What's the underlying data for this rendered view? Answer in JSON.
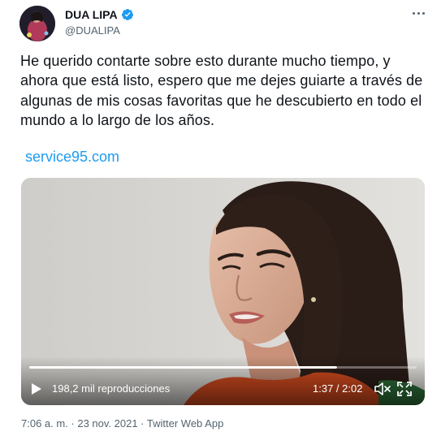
{
  "author": {
    "display_name": "DUA LIPA",
    "handle": "@DUALIPA",
    "verified_icon": "verified-badge-icon",
    "verified_color": "#1d9bf0"
  },
  "tweet": {
    "text": "He querido contarte sobre esto durante mucho tiempo, y ahora que está listo, espero que me dejes guiarte a través de algunas de mis cosas favoritas que he descubierto en todo el mundo a lo largo de los años.",
    "link": "service95.com",
    "link_color": "#1d9bf0"
  },
  "video": {
    "views": "198,2 mil reproducciones",
    "time": "1:37 / 2:02",
    "progress": 0.795
  },
  "meta": {
    "timestamp": "7:06 a. m. · 23 nov. 2021 · Twitter Web App"
  },
  "colors": {
    "text": "#0f1419",
    "secondary": "#536471"
  }
}
